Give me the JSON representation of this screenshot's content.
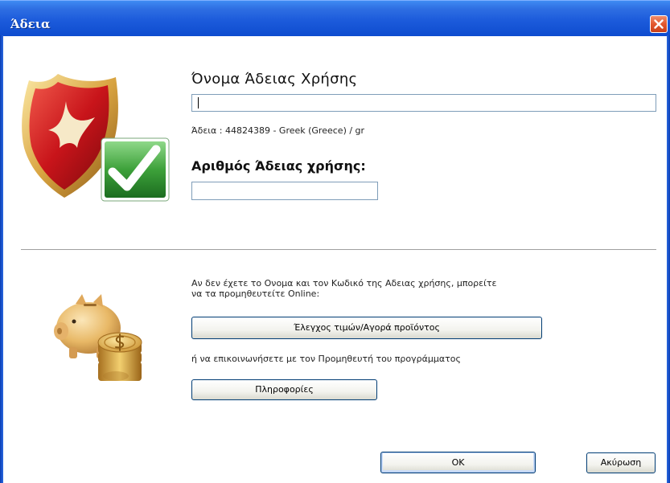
{
  "window": {
    "title": "Άδεια"
  },
  "license": {
    "name_heading": "Όνομα Άδειας Χρήσης",
    "name_value": "",
    "info": "Άδεια : 44824389 - Greek (Greece) / gr",
    "number_heading": "Αριθμός Άδειας χρήσης:",
    "number_value": ""
  },
  "online": {
    "line1": "Αν δεν έχετε το Ονομα και τον Κωδικό της Αδειας χρήσης, μπορείτε",
    "line2": "να τα προμηθευτείτε Online:",
    "price_button": "Έλεγχος τιμών/Αγορά προϊόντος",
    "or_text": "ή να επικοινωνήσετε με τον Προμηθευτή του προγράμματος",
    "info_button": "Πληροφορίες"
  },
  "footer": {
    "ok_label": "OK",
    "cancel_label": "Ακύρωση"
  },
  "icons": {
    "close": "close-icon",
    "shield": "shield-checkmark-icon",
    "piggy": "piggy-bank-coins-icon"
  },
  "colors": {
    "titlebar": "#1c5bdb",
    "close_button": "#e3582e",
    "input_border": "#7f9db9",
    "button_border": "#003c74"
  }
}
